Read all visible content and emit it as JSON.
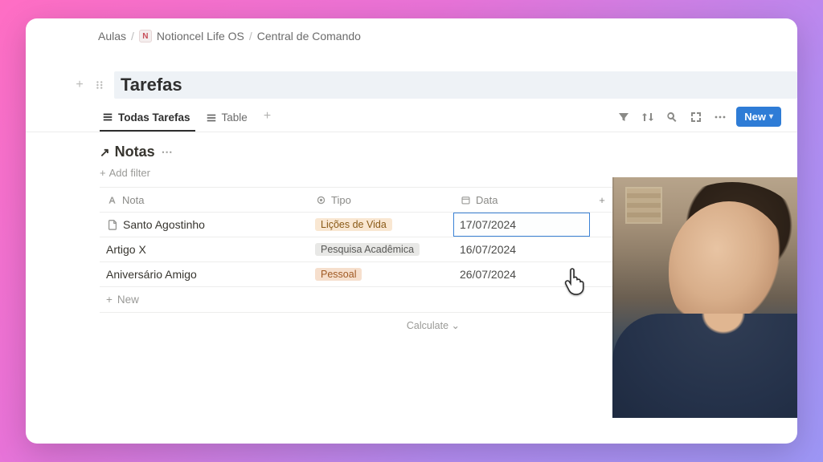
{
  "breadcrumb": {
    "item1": "Aulas",
    "icon_letter": "N",
    "item2": "Notioncel Life OS",
    "item3": "Central de Comando"
  },
  "section": {
    "title": "Tarefas"
  },
  "tabs": {
    "active": "Todas Tarefas",
    "second": "Table"
  },
  "toolbar": {
    "new_label": "New"
  },
  "database": {
    "title": "Notas",
    "add_filter": "Add filter",
    "columns": {
      "nota": "Nota",
      "tipo": "Tipo",
      "data": "Data"
    },
    "rows": [
      {
        "nota": "Santo Agostinho",
        "tipo": "Lições de Vida",
        "tipo_style": "orange",
        "data": "17/07/2024",
        "has_icon": true,
        "selected": true
      },
      {
        "nota": "Artigo X",
        "tipo": "Pesquisa Acadêmica",
        "tipo_style": "gray",
        "data": "16/07/2024",
        "has_icon": false,
        "selected": false
      },
      {
        "nota": "Aniversário Amigo",
        "tipo": "Pessoal",
        "tipo_style": "peach",
        "data": "26/07/2024",
        "has_icon": false,
        "selected": false
      }
    ],
    "new_row": "New",
    "calculate": "Calculate"
  }
}
